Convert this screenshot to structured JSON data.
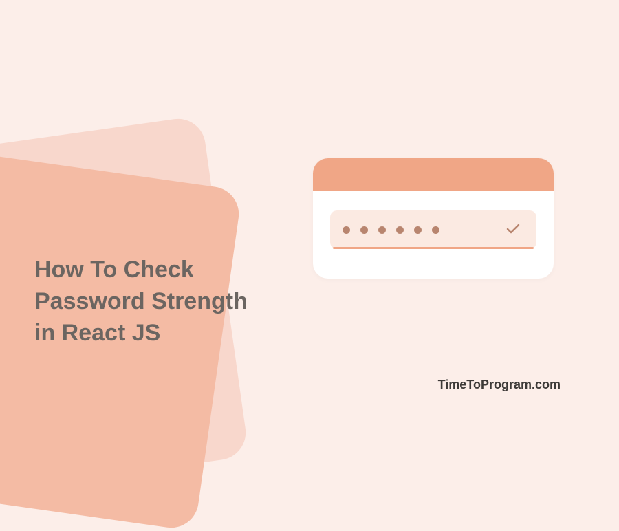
{
  "title": {
    "line1": "How To Check",
    "line2": "Password Strength",
    "line3": "in React JS"
  },
  "card": {
    "dot_count": 6,
    "check_visible": true
  },
  "colors": {
    "background": "#fceee9",
    "shape_back": "#f8d7cc",
    "shape_front": "#f4bba4",
    "card_header": "#f0a686",
    "field_bg": "#fbeae2",
    "dot": "#b8856f",
    "title_text": "#6b6561"
  },
  "watermark": "TimeToProgram.com"
}
